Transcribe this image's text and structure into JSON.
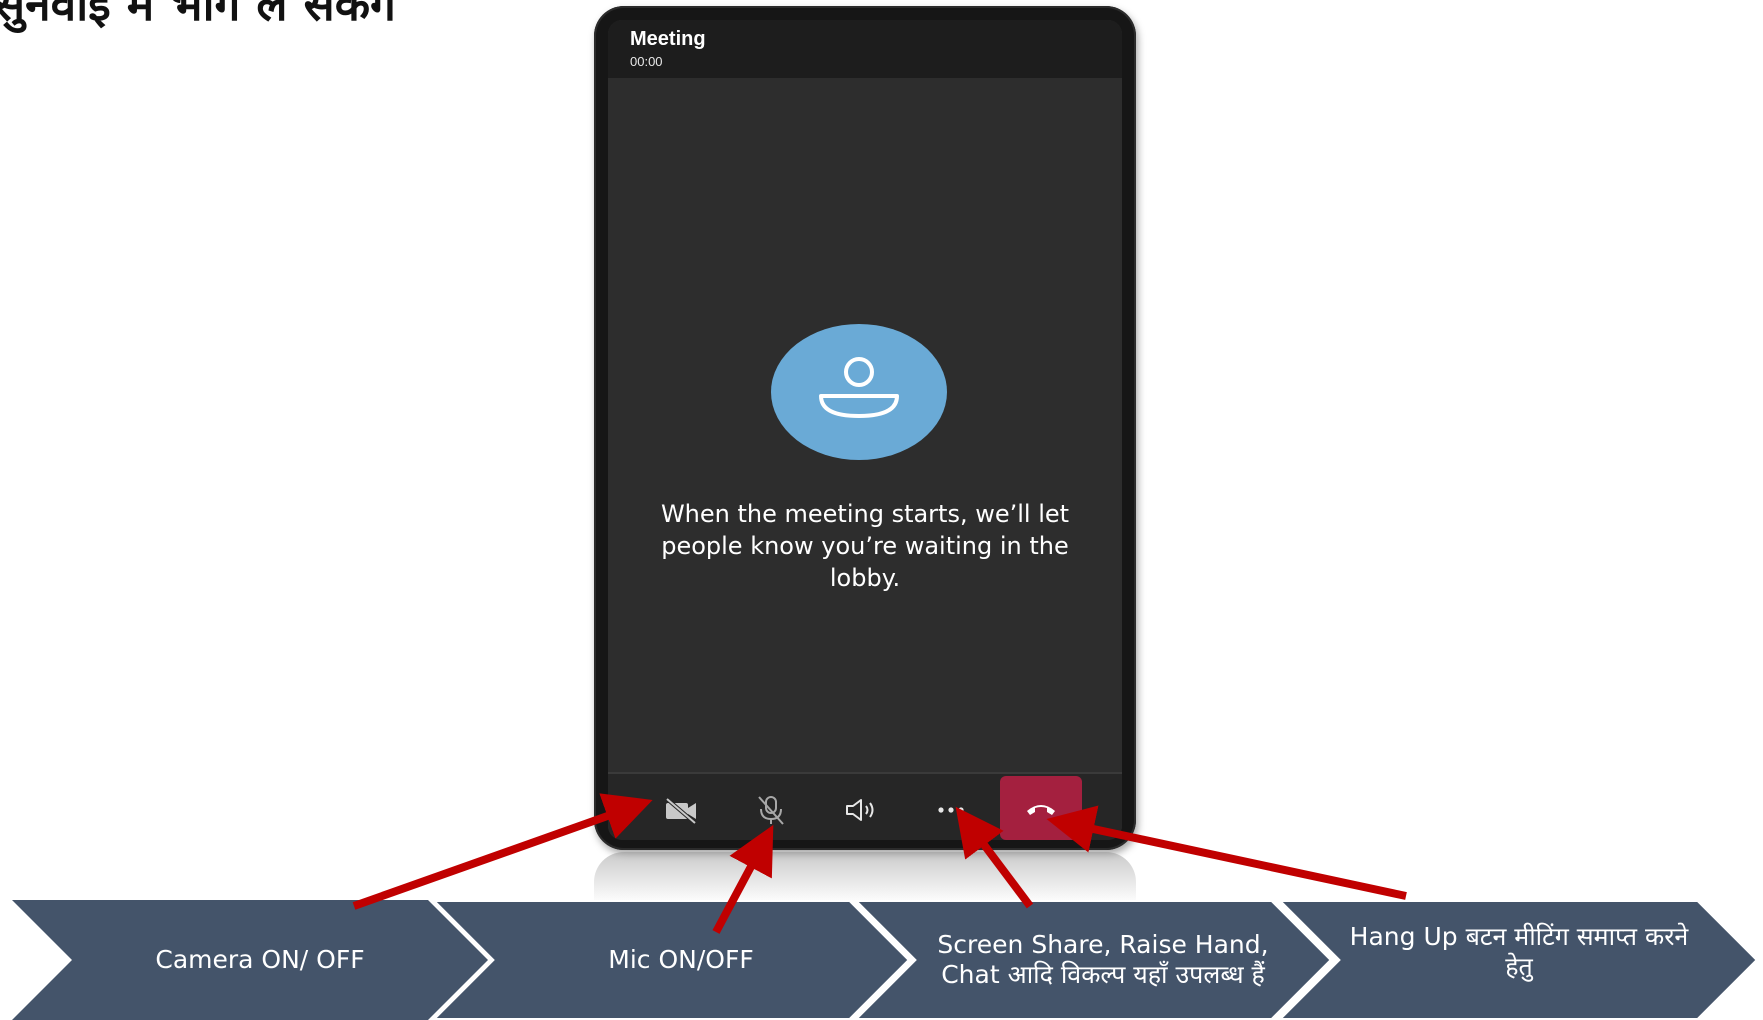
{
  "heading": "सुनवाई में भाग ले सकेंगे",
  "meeting": {
    "title": "Meeting",
    "timer": "00:00",
    "lobby_message": "When the meeting starts, we’ll let people know you’re waiting in the lobby."
  },
  "controls": [
    {
      "name": "camera-off-icon",
      "label": ""
    },
    {
      "name": "mic-off-icon",
      "label": ""
    },
    {
      "name": "speaker-icon",
      "label": ""
    },
    {
      "name": "more-options-icon",
      "label": ""
    },
    {
      "name": "hang-up-icon",
      "label": ""
    }
  ],
  "steps": [
    {
      "label": "Camera ON/ OFF"
    },
    {
      "label": "Mic ON/OFF"
    },
    {
      "label": "Screen Share, Raise Hand, Chat आदि विकल्प यहाँ उपलब्ध हैं"
    },
    {
      "label": "Hang Up बटन मीटिंग समाप्त करने हेतु"
    }
  ],
  "colors": {
    "chevron": "#44546a",
    "arrow": "#c00000",
    "hangup": "#a4203f",
    "avatar": "#6aaad6"
  }
}
